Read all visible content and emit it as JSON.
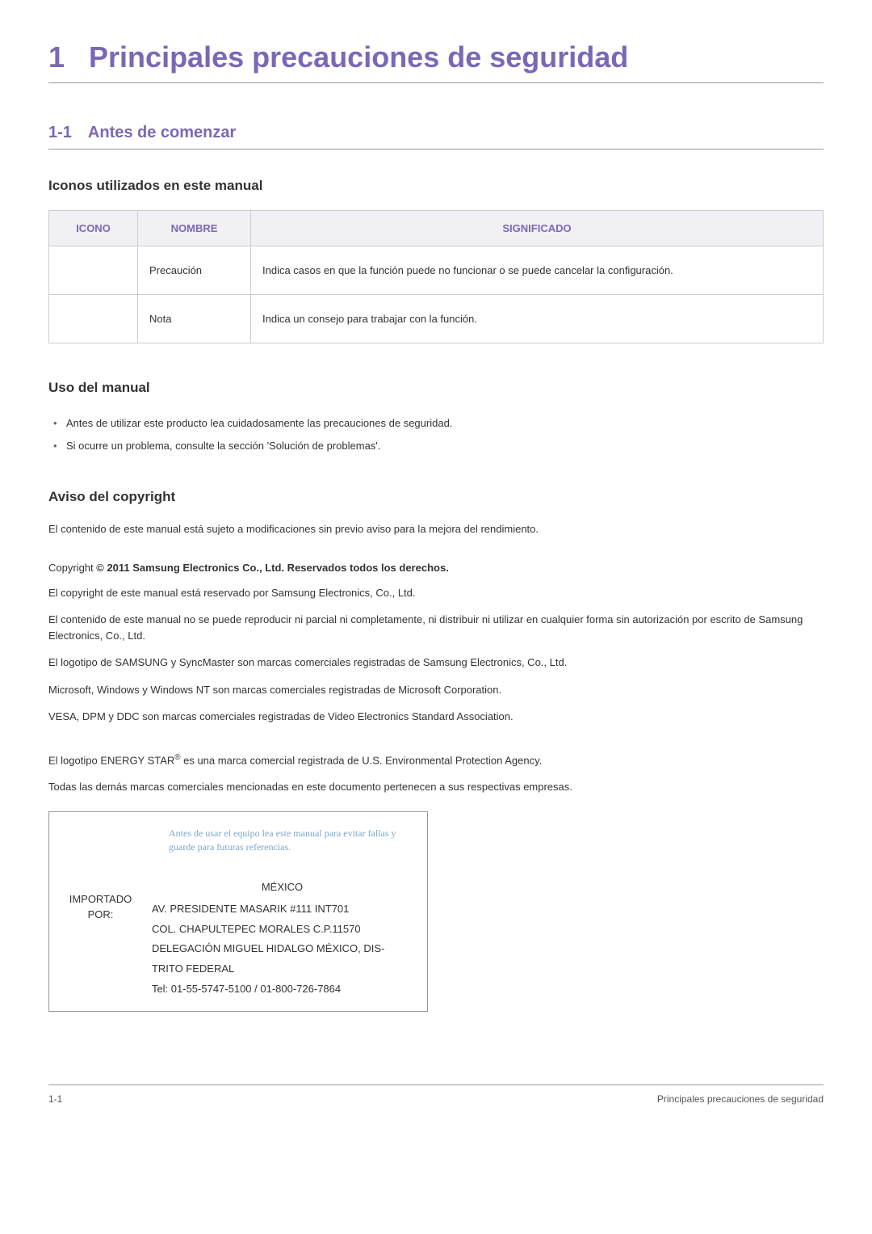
{
  "mainTitle": {
    "num": "1",
    "text": "Principales precauciones de seguridad"
  },
  "section11": {
    "num": "1-1",
    "text": "Antes de comenzar"
  },
  "iconsHeading": "Iconos utilizados en este manual",
  "table": {
    "headers": {
      "icon": "ICONO",
      "name": "NOMBRE",
      "meaning": "SIGNIFICADO"
    },
    "rows": [
      {
        "name": "Precaución",
        "meaning": "Indica casos en que la función puede no funcionar o se puede cancelar la configuración."
      },
      {
        "name": "Nota",
        "meaning": "Indica un consejo para trabajar con la función."
      }
    ]
  },
  "usoHeading": "Uso del manual",
  "usoBullets": [
    "Antes de utilizar este producto lea cuidadosamente las precauciones de seguridad.",
    "Si ocurre un problema, consulte la sección 'Solución de problemas'."
  ],
  "copyrightHeading": "Aviso del copyright",
  "copyrightIntro": "El contenido de este manual está sujeto a modificaciones sin previo aviso para la mejora del rendimiento.",
  "copyrightPrefix": "Copyright ",
  "copyrightBold": "© 2011 Samsung Electronics Co., Ltd. Reservados todos los derechos.",
  "copyrightParas": [
    "El copyright de este manual está reservado por Samsung Electronics, Co., Ltd.",
    "El contenido de este manual no se puede reproducir ni parcial ni completamente, ni distribuir ni utilizar en cualquier forma sin autorización por escrito de Samsung Electronics, Co., Ltd.",
    "El logotipo de SAMSUNG y SyncMaster son marcas comerciales registradas de Samsung Electronics, Co., Ltd.",
    "Microsoft, Windows y Windows NT son marcas comerciales registradas de Microsoft Corporation.",
    "VESA, DPM y DDC son marcas comerciales registradas de Video Electronics Standard Association."
  ],
  "energyStar": {
    "pre": "El logotipo ENERGY STAR",
    "sup": "®",
    "post": " es una marca comercial registrada de U.S. Environmental Protection Agency."
  },
  "closingTrademark": "Todas las demás marcas comerciales mencionadas en este documento pertenecen a sus respectivas empresas.",
  "importBox": {
    "handwriting": "Antes de usar el equipo lea este manual para evitar fallas y guarde para futuras referencias.",
    "label": "IMPORTADO POR:",
    "country": "MÉXICO",
    "lines": [
      "AV. PRESIDENTE MASARIK #111 INT701",
      "COL. CHAPULTEPEC MORALES C.P.11570",
      "DELEGACIÓN MIGUEL HIDALGO MÉXICO, DIS-TRITO FEDERAL",
      "Tel: 01-55-5747-5100 / 01-800-726-7864"
    ]
  },
  "footer": {
    "left": "1-1",
    "right": "Principales precauciones de seguridad"
  }
}
